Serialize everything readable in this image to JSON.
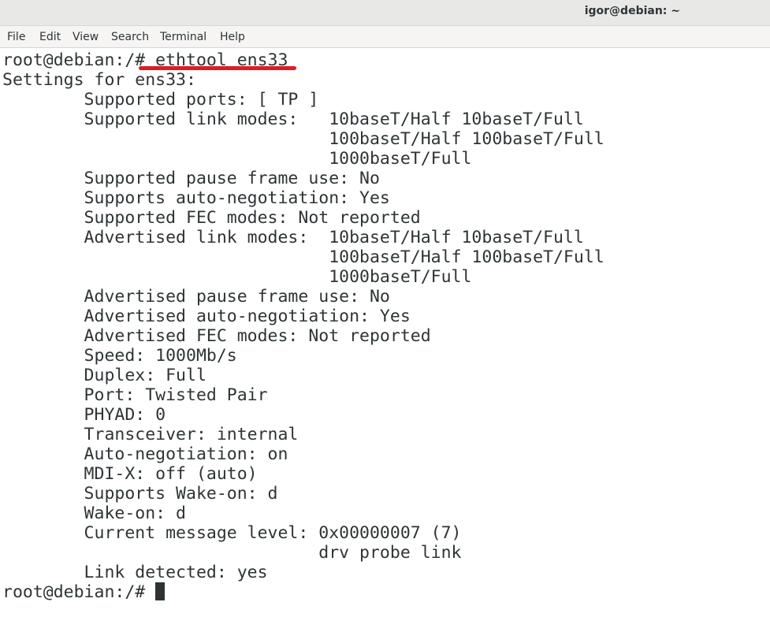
{
  "window": {
    "title": "igor@debian: ~"
  },
  "menu": [
    {
      "label": "File"
    },
    {
      "label": "Edit"
    },
    {
      "label": "View"
    },
    {
      "label": "Search"
    },
    {
      "label": "Terminal"
    },
    {
      "label": "Help"
    }
  ],
  "terminal": {
    "lines": [
      "root@debian:/# ethtool ens33",
      "Settings for ens33:",
      "        Supported ports: [ TP ]",
      "        Supported link modes:   10baseT/Half 10baseT/Full",
      "                                100baseT/Half 100baseT/Full",
      "                                1000baseT/Full",
      "        Supported pause frame use: No",
      "        Supports auto-negotiation: Yes",
      "        Supported FEC modes: Not reported",
      "        Advertised link modes:  10baseT/Half 10baseT/Full",
      "                                100baseT/Half 100baseT/Full",
      "                                1000baseT/Full",
      "        Advertised pause frame use: No",
      "        Advertised auto-negotiation: Yes",
      "        Advertised FEC modes: Not reported",
      "        Speed: 1000Mb/s",
      "        Duplex: Full",
      "        Port: Twisted Pair",
      "        PHYAD: 0",
      "        Transceiver: internal",
      "        Auto-negotiation: on",
      "        MDI-X: off (auto)",
      "        Supports Wake-on: d",
      "        Wake-on: d",
      "        Current message level: 0x00000007 (7)",
      "                               drv probe link",
      "        Link detected: yes"
    ],
    "prompt": "root@debian:/# "
  },
  "colors": {
    "text": "#2e3436",
    "background": "#ffffff",
    "annotation": "#e01b24"
  }
}
